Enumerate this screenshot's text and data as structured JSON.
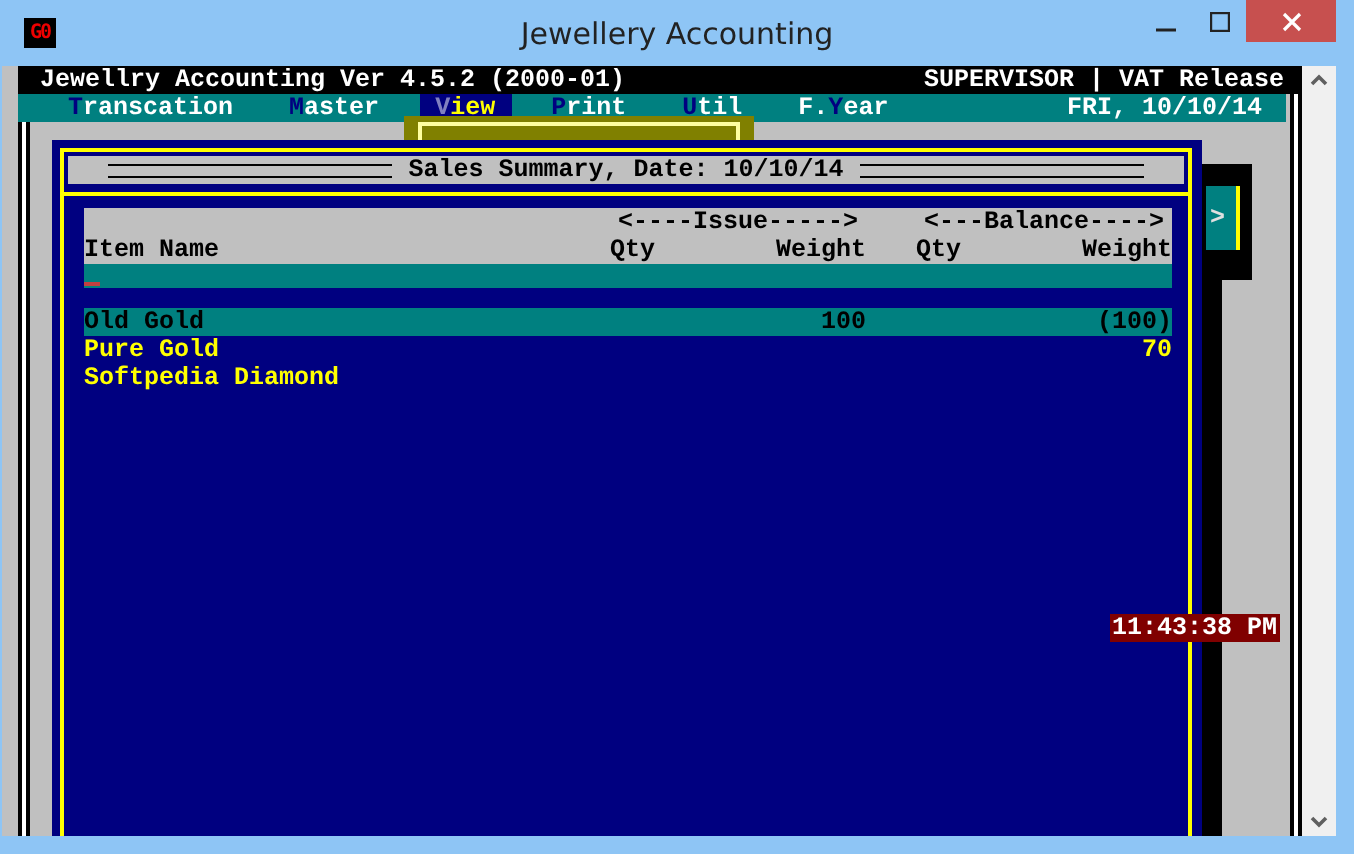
{
  "window": {
    "title": "Jewellery Accounting",
    "icon_text": "G0"
  },
  "console": {
    "title": "Jewellry Accounting Ver 4.5.2 (2000-01)",
    "user": "SUPERVISOR | VAT Release",
    "date": "FRI, 10/10/14"
  },
  "menu": [
    {
      "hotkey": "T",
      "rest": "ranscation",
      "selected": false
    },
    {
      "hotkey": "M",
      "rest": "aster",
      "selected": false
    },
    {
      "hotkey": "V",
      "rest": "iew",
      "selected": true
    },
    {
      "hotkey": "P",
      "rest": "rint",
      "selected": false
    },
    {
      "hotkey": "U",
      "rest": "til",
      "selected": false
    },
    {
      "prefix": "F.",
      "hotkey": "Y",
      "rest": "ear",
      "selected": false
    }
  ],
  "side_panel": {
    "text": ">"
  },
  "dialog": {
    "title": "Sales Summary, Date: 10/10/14",
    "groups": [
      "<----Issue----->",
      "<---Balance---->"
    ],
    "columns": [
      "Item Name",
      "Qty",
      "Weight",
      "Qty",
      "Weight"
    ],
    "rows": [
      {
        "item": "Old Gold",
        "issue_weight": "100",
        "balance_weight": "(100)",
        "selected": true
      },
      {
        "item": "Pure Gold",
        "balance_weight": "70",
        "selected": false
      },
      {
        "item": "Softpedia Diamond",
        "selected": false
      }
    ]
  },
  "clock": "11:43:38 PM"
}
